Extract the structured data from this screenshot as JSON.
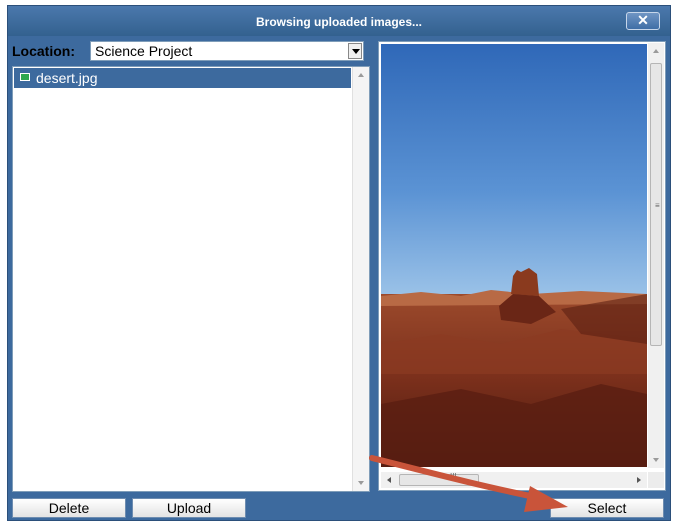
{
  "dialog": {
    "title": "Browsing uploaded images...",
    "close_label": "✕"
  },
  "location": {
    "label": "Location:",
    "value": "Science Project"
  },
  "file_list": {
    "items": [
      {
        "name": "desert.jpg",
        "icon": "image-file-icon",
        "selected": true
      }
    ]
  },
  "preview": {
    "description_icon": "image-preview",
    "scrollbar_h_grip": "III",
    "scrollbar_v_grip": "≡"
  },
  "buttons": {
    "delete": "Delete",
    "upload": "Upload",
    "select": "Select"
  },
  "colors": {
    "dialog_blue": "#3d6a9e",
    "selection_blue": "#3d6a9e",
    "annotation_arrow": "#c9543a"
  }
}
